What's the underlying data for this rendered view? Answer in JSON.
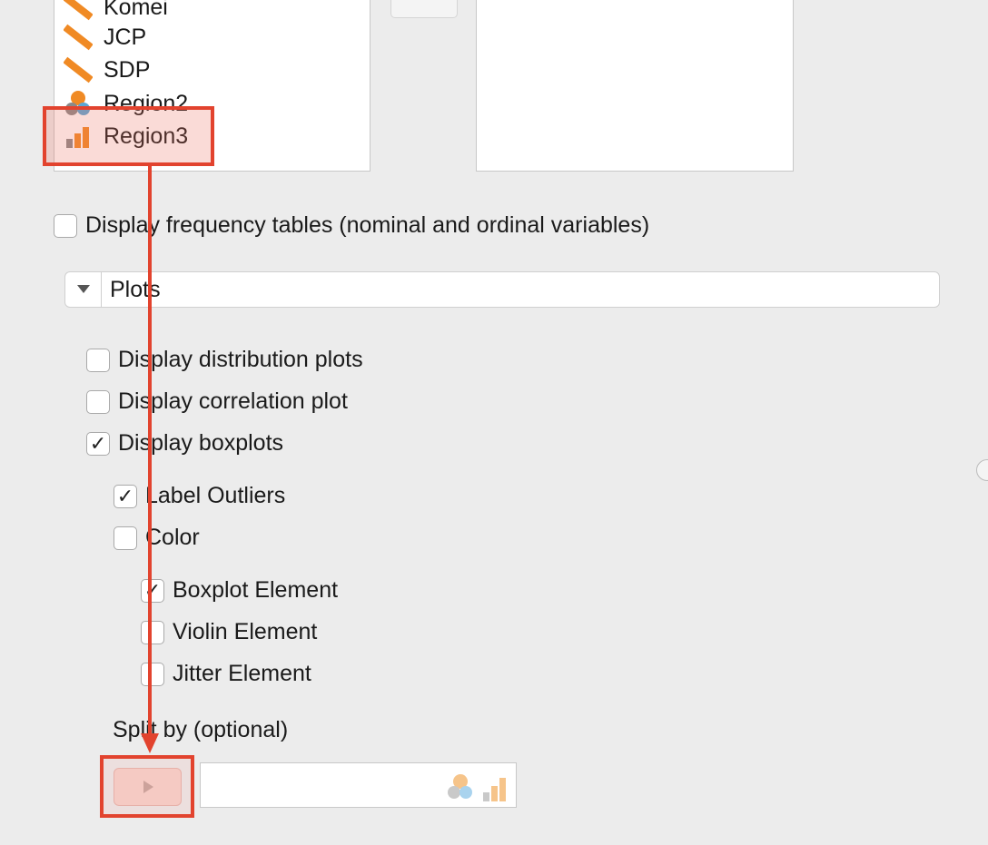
{
  "variables": [
    {
      "label": "Komei",
      "icon": "scale-icon"
    },
    {
      "label": "JCP",
      "icon": "scale-icon"
    },
    {
      "label": "SDP",
      "icon": "scale-icon"
    },
    {
      "label": "Region2",
      "icon": "nominal-icon"
    },
    {
      "label": "Region3",
      "icon": "ordinal-icon"
    }
  ],
  "frequency_tables_label": "Display frequency tables (nominal and ordinal variables)",
  "plots": {
    "section_label": "Plots",
    "distribution_label": "Display distribution plots",
    "correlation_label": "Display correlation plot",
    "boxplots_label": "Display boxplots",
    "label_outliers_label": "Label Outliers",
    "color_label": "Color",
    "boxplot_element_label": "Boxplot Element",
    "violin_element_label": "Violin Element",
    "jitter_element_label": "Jitter Element",
    "split_by_label": "Split by (optional)"
  },
  "states": {
    "frequency_tables": false,
    "distribution": false,
    "correlation": false,
    "boxplots": true,
    "label_outliers": true,
    "color": false,
    "boxplot_element": true,
    "violin_element": false,
    "jitter_element": false
  },
  "colors": {
    "annotation": "#e2432e",
    "scale_icon": "#f08a24",
    "nominal_orange": "#f08a24",
    "nominal_blue": "#5aa7d6"
  }
}
